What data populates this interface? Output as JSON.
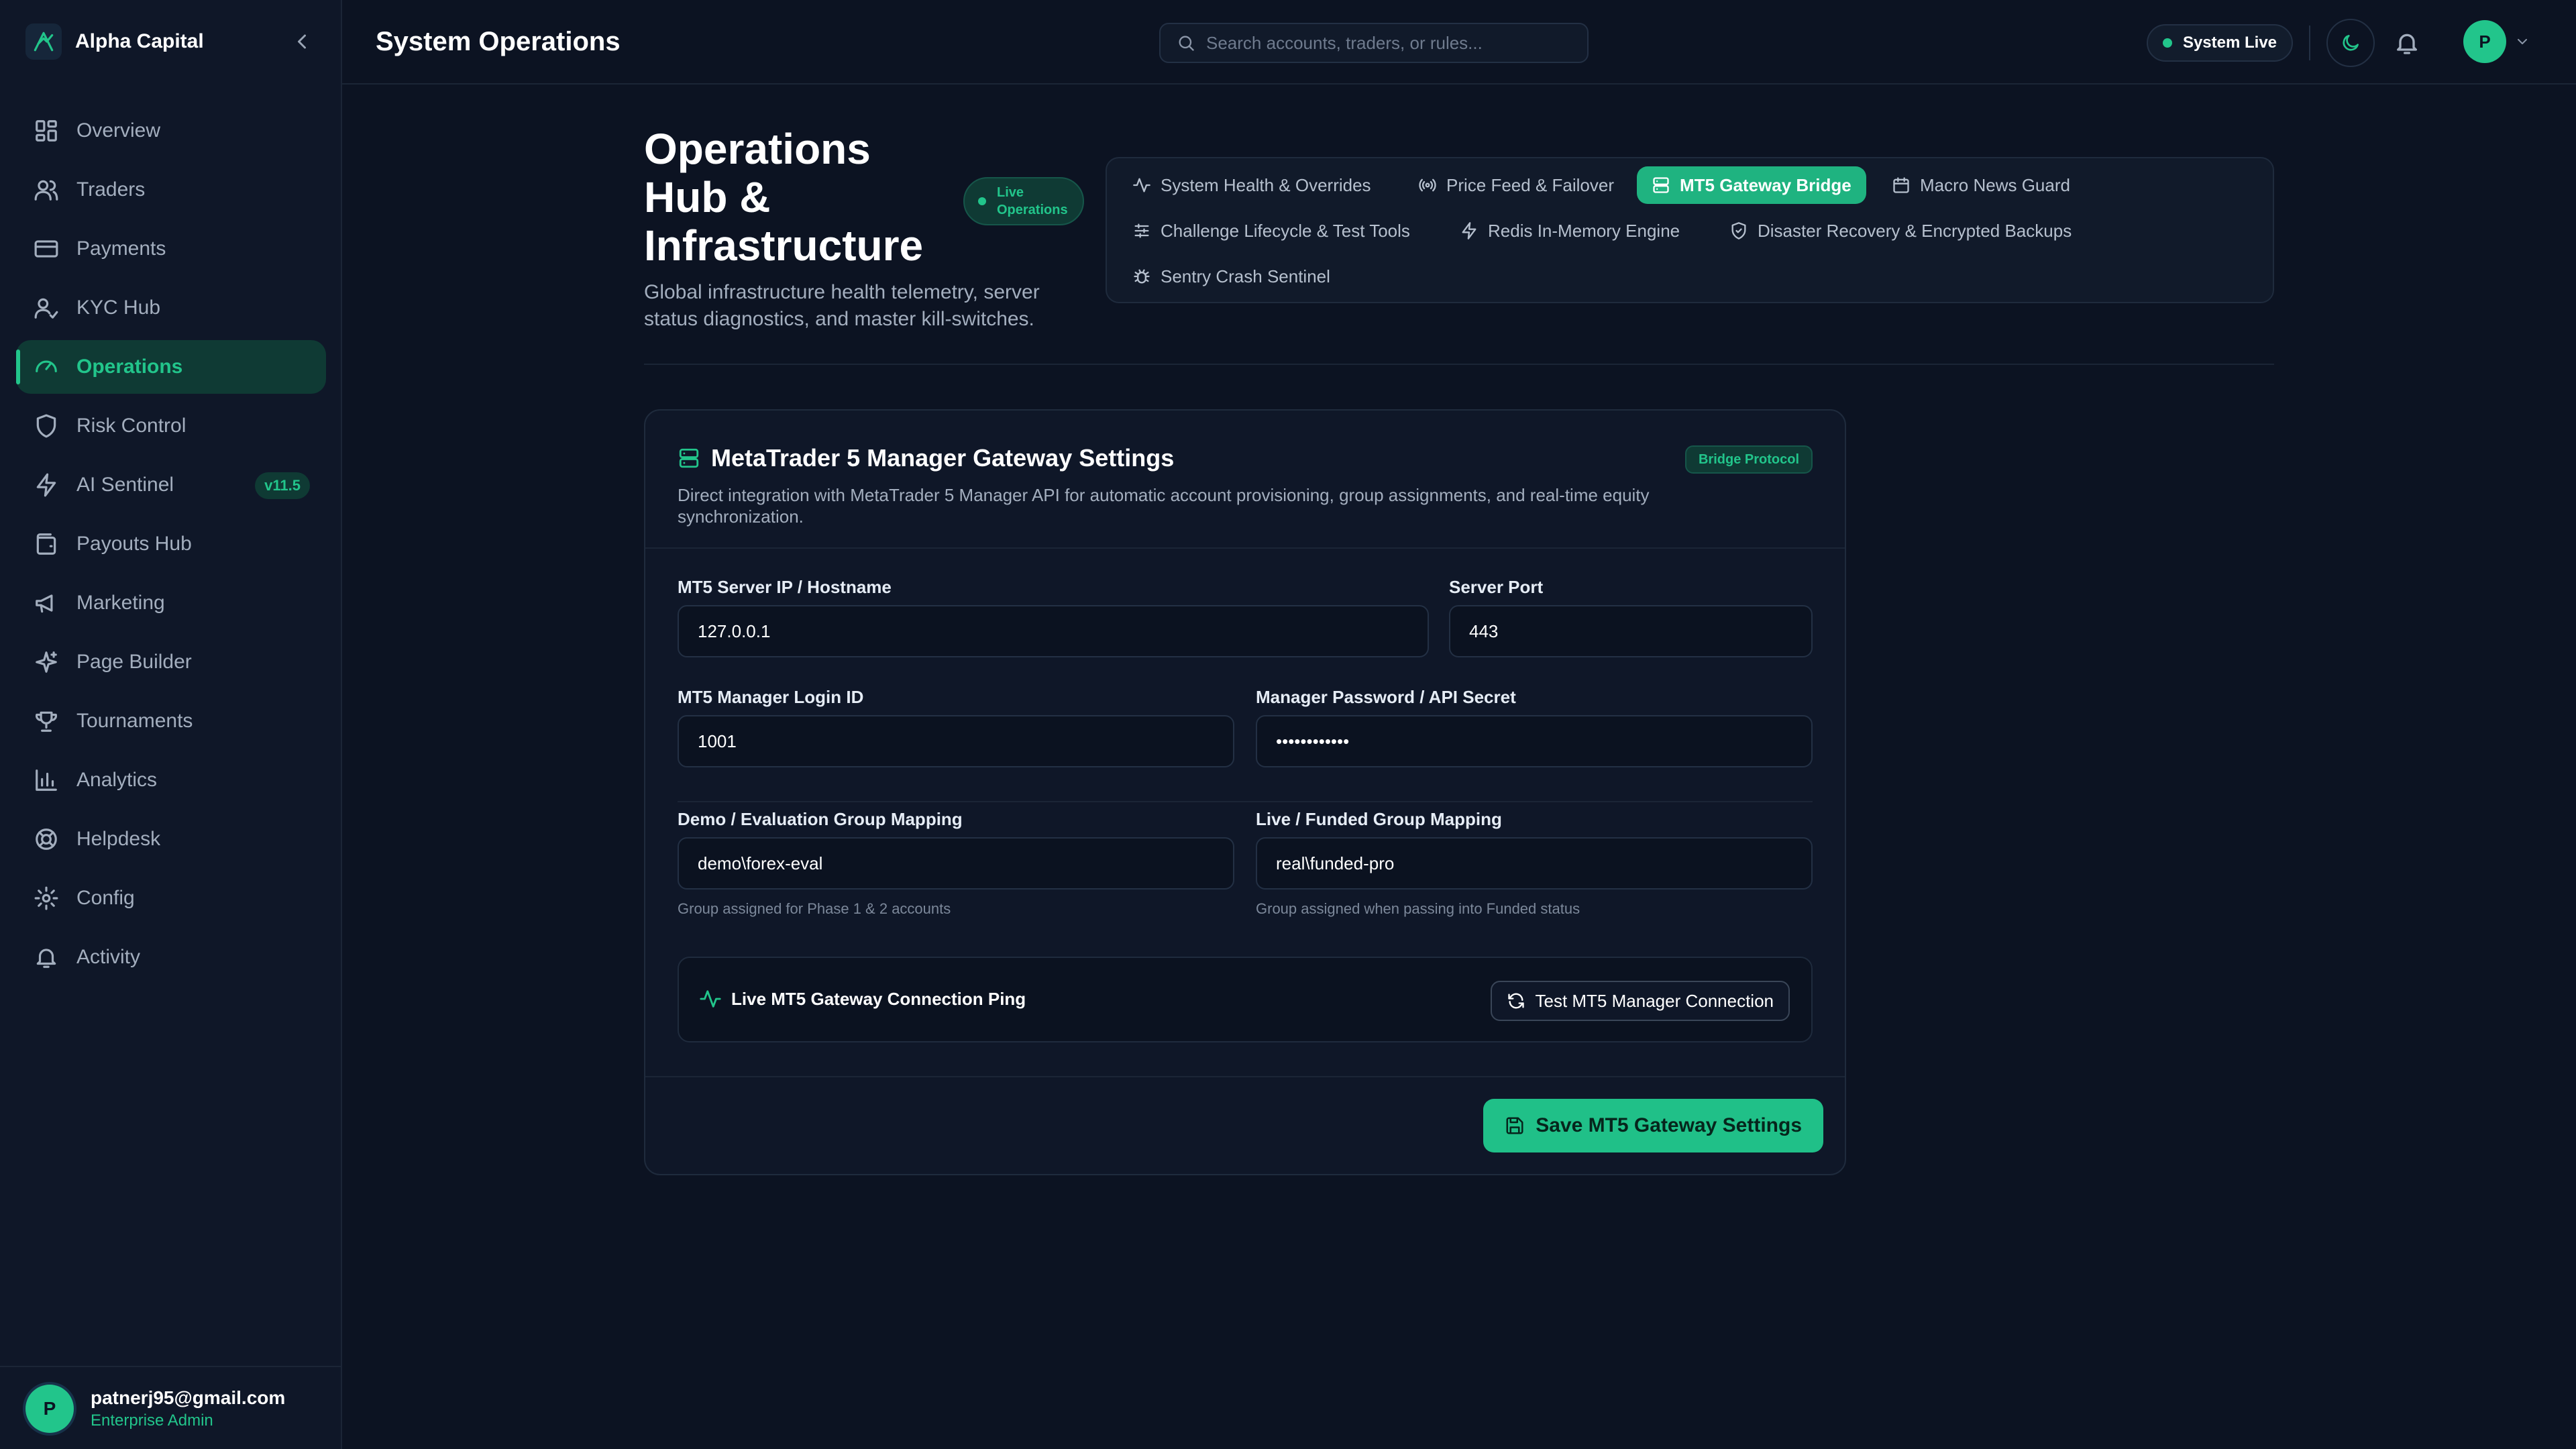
{
  "brand": {
    "name": "Alpha Capital"
  },
  "sidebar": {
    "items": [
      {
        "label": "Overview"
      },
      {
        "label": "Traders"
      },
      {
        "label": "Payments"
      },
      {
        "label": "KYC Hub"
      },
      {
        "label": "Operations"
      },
      {
        "label": "Risk Control"
      },
      {
        "label": "AI Sentinel",
        "badge": "v11.5"
      },
      {
        "label": "Payouts Hub"
      },
      {
        "label": "Marketing"
      },
      {
        "label": "Page Builder"
      },
      {
        "label": "Tournaments"
      },
      {
        "label": "Analytics"
      },
      {
        "label": "Helpdesk"
      },
      {
        "label": "Config"
      },
      {
        "label": "Activity"
      }
    ],
    "active_item": "Operations",
    "user": {
      "initial": "P",
      "email": "patnerj95@gmail.com",
      "role": "Enterprise Admin"
    }
  },
  "header": {
    "title": "System Operations",
    "search_placeholder": "Search accounts, traders, or rules...",
    "status": "System Live",
    "avatar_initial": "P"
  },
  "hero": {
    "title": "Operations Hub & Infrastructure",
    "badge": "Live Operations",
    "subtitle": "Global infrastructure health telemetry, server status diagnostics, and master kill-switches."
  },
  "tabs": [
    {
      "label": "System Health & Overrides"
    },
    {
      "label": "Price Feed & Failover"
    },
    {
      "label": "MT5 Gateway Bridge"
    },
    {
      "label": "Macro News Guard"
    },
    {
      "label": "Challenge Lifecycle & Test Tools"
    },
    {
      "label": "Redis In-Memory Engine"
    },
    {
      "label": "Disaster Recovery & Encrypted Backups"
    },
    {
      "label": "Sentry Crash Sentinel"
    }
  ],
  "active_tab": "MT5 Gateway Bridge",
  "card": {
    "title": "MetaTrader 5 Manager Gateway Settings",
    "badge": "Bridge Protocol",
    "description": "Direct integration with MetaTrader 5 Manager API for automatic account provisioning, group assignments, and real-time equity synchronization.",
    "fields": {
      "server_ip": {
        "label": "MT5 Server IP / Hostname",
        "value": "127.0.0.1"
      },
      "server_port": {
        "label": "Server Port",
        "value": "443"
      },
      "login_id": {
        "label": "MT5 Manager Login ID",
        "value": "1001"
      },
      "password": {
        "label": "Manager Password / API Secret",
        "value": "••••••••••••"
      },
      "demo_group": {
        "label": "Demo / Evaluation Group Mapping",
        "value": "demo\\forex-eval",
        "hint": "Group assigned for Phase 1 & 2 accounts"
      },
      "live_group": {
        "label": "Live / Funded Group Mapping",
        "value": "real\\funded-pro",
        "hint": "Group assigned when passing into Funded status"
      }
    },
    "ping": {
      "label": "Live MT5 Gateway Connection Ping",
      "button": "Test MT5 Manager Connection"
    },
    "save_button": "Save MT5 Gateway Settings"
  },
  "colors": {
    "accent": "#22c58b",
    "background": "#0c1322",
    "panel": "#0f1728"
  }
}
